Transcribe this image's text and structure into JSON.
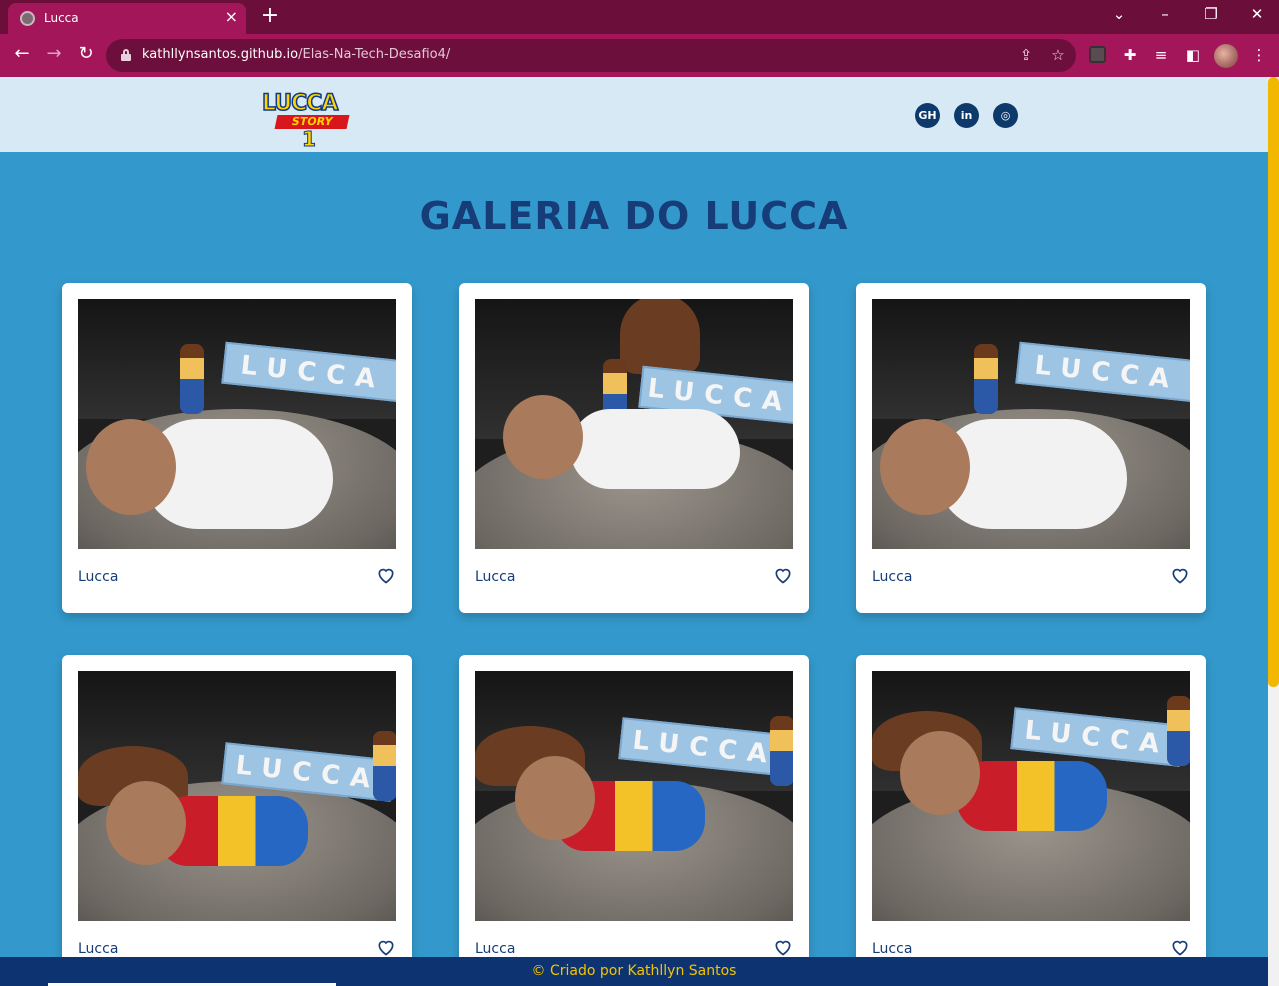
{
  "browser": {
    "tab_title": "Lucca",
    "url_host": "kathllynsantos.github.io",
    "url_path": "/Elas-Na-Tech-Desafio4/"
  },
  "header": {
    "logo": {
      "line1": "LUCCA",
      "line2": "STORY",
      "line3": "1"
    },
    "social": [
      {
        "name": "github-icon",
        "glyph": "GH"
      },
      {
        "name": "linkedin-icon",
        "glyph": "in"
      },
      {
        "name": "instagram-icon",
        "glyph": "◎"
      }
    ]
  },
  "main": {
    "title": "GALERIA DO LUCCA",
    "cards": [
      {
        "caption": "Lucca"
      },
      {
        "caption": "Lucca"
      },
      {
        "caption": "Lucca"
      },
      {
        "caption": "Lucca"
      },
      {
        "caption": "Lucca"
      },
      {
        "caption": "Lucca"
      }
    ]
  },
  "footer": {
    "text": "© Criado por Kathllyn Santos"
  },
  "colors": {
    "accent": "#3399cc",
    "header": "#d7e9f5",
    "footer": "#0d3370",
    "title": "#163d78",
    "footer_text": "#f5c400"
  }
}
